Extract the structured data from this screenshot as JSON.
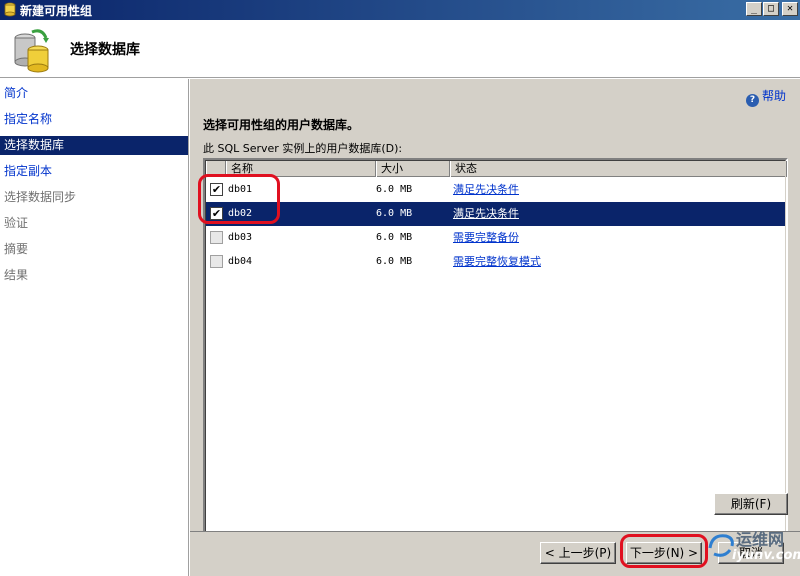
{
  "window": {
    "title": "新建可用性组",
    "minimize_glyph": "_",
    "maximize_glyph": "□",
    "close_glyph": "✕"
  },
  "header": {
    "title": "选择数据库"
  },
  "sidebar": {
    "items": [
      {
        "label": "简介",
        "state": "link"
      },
      {
        "label": "指定名称",
        "state": "link"
      },
      {
        "label": "选择数据库",
        "state": "active"
      },
      {
        "label": "指定副本",
        "state": "link"
      },
      {
        "label": "选择数据同步",
        "state": "disabled"
      },
      {
        "label": "验证",
        "state": "disabled"
      },
      {
        "label": "摘要",
        "state": "disabled"
      },
      {
        "label": "结果",
        "state": "disabled"
      }
    ]
  },
  "main": {
    "help_label": "帮助",
    "help_glyph": "?",
    "section_title": "选择可用性组的用户数据库。",
    "table_label": "此 SQL Server 实例上的用户数据库(D):",
    "columns": [
      "名称",
      "大小",
      "状态"
    ],
    "rows": [
      {
        "name": "db01",
        "size": "6.0 MB",
        "status": "满足先决条件",
        "checked": true,
        "selected": false
      },
      {
        "name": "db02",
        "size": "6.0 MB",
        "status": "满足先决条件",
        "checked": true,
        "selected": true
      },
      {
        "name": "db03",
        "size": "6.0 MB",
        "status": "需要完整备份",
        "checked": false,
        "selected": false
      },
      {
        "name": "db04",
        "size": "6.0 MB",
        "status": "需要完整恢复模式",
        "checked": false,
        "selected": false
      }
    ],
    "check_glyph": "✔",
    "refresh_label": "刷新(F)"
  },
  "footer": {
    "prev_label": "< 上一步(P)",
    "next_label": "下一步(N) >",
    "cancel_label": "取消"
  },
  "watermark": {
    "text": "运维网",
    "sub": "iyunv.com"
  },
  "colors": {
    "accent": "#0a246a",
    "link": "#0033cc",
    "annotation": "#e01020",
    "panel": "#d4d0c8"
  }
}
